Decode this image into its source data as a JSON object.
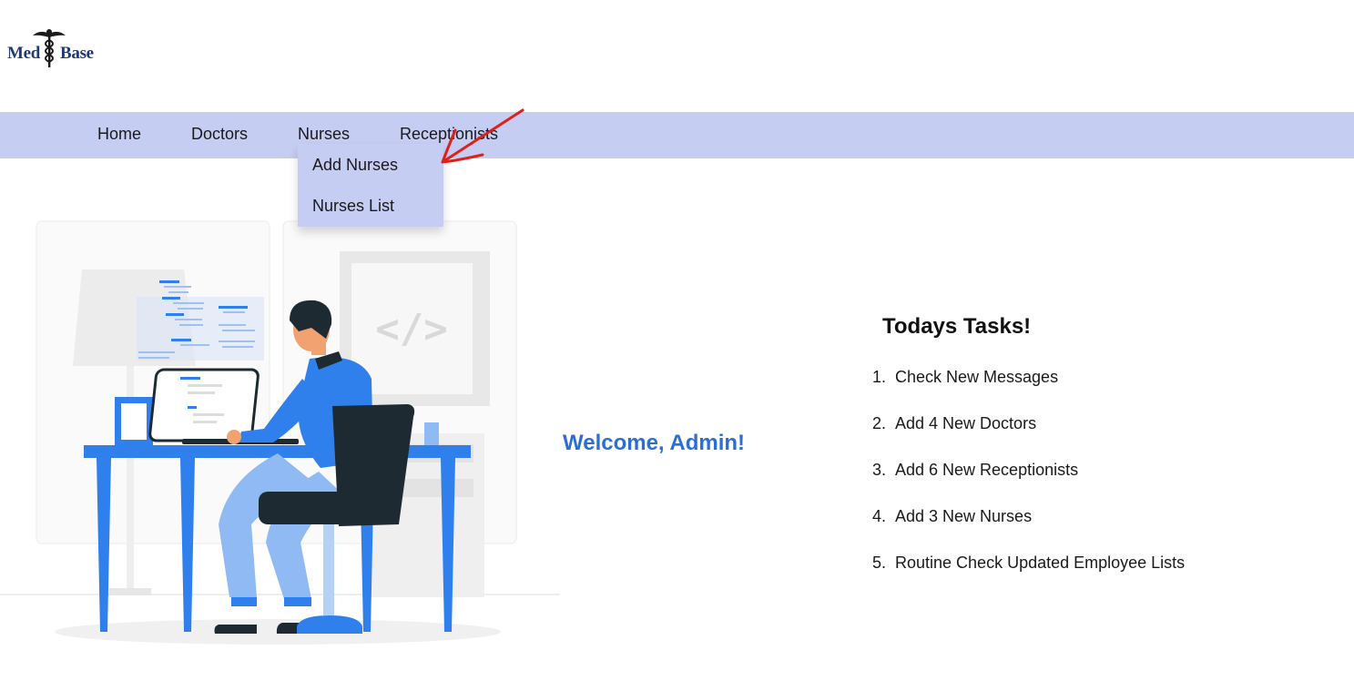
{
  "logo": {
    "left_text": "Med",
    "right_text": "Base",
    "icon": "caduceus-icon"
  },
  "nav": {
    "items": [
      {
        "label": "Home"
      },
      {
        "label": "Doctors"
      },
      {
        "label": "Nurses"
      },
      {
        "label": "Receptionists"
      }
    ]
  },
  "dropdown": {
    "items": [
      {
        "label": "Add Nurses"
      },
      {
        "label": "Nurses List"
      }
    ]
  },
  "annotation": {
    "icon": "red-arrow-icon",
    "color": "#e0201a"
  },
  "illustration": {
    "icon": "developer-at-desk-illustration",
    "code_symbol": "</>"
  },
  "welcome": {
    "text": "Welcome, Admin!",
    "color": "#2b6fd6"
  },
  "tasks": {
    "title": "Todays Tasks!",
    "items": [
      {
        "number": "1.",
        "text": "Check New Messages"
      },
      {
        "number": "2.",
        "text": "Add 4 New Doctors"
      },
      {
        "number": "3.",
        "text": "Add 6 New Receptionists"
      },
      {
        "number": "4.",
        "text": "Add 3 New Nurses"
      },
      {
        "number": "5.",
        "text": "Routine Check Updated Employee Lists"
      }
    ]
  },
  "colors": {
    "navbar": "#c6cdf2",
    "brand": "#1f3a76",
    "accent_blue": "#2f80ed"
  }
}
